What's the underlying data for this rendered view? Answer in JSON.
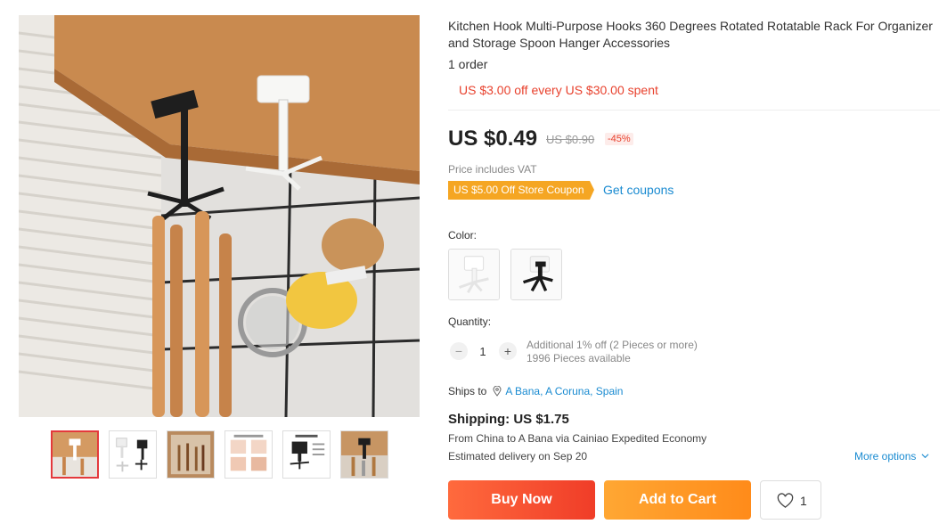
{
  "product": {
    "title": "Kitchen Hook Multi-Purpose Hooks 360 Degrees Rotated Rotatable Rack For Organizer and Storage Spoon Hanger Accessories",
    "orders": "1 order",
    "promo": "US $3.00 off every US $30.00 spent",
    "price": "US $0.49",
    "original_price": "US $0.90",
    "discount": "-45%",
    "vat_note": "Price includes VAT",
    "coupon_badge": "US $5.00 Off Store Coupon",
    "get_coupons": "Get coupons"
  },
  "gallery": {
    "main_image_icon": "kitchen-hook-photo",
    "thumbnails": [
      {
        "icon": "hook-photo-white",
        "active": true
      },
      {
        "icon": "hook-photo-product-set"
      },
      {
        "icon": "hook-photo-cabinet"
      },
      {
        "icon": "hook-photo-how-to-use"
      },
      {
        "icon": "hook-photo-product-details"
      },
      {
        "icon": "hook-photo-black"
      }
    ]
  },
  "color": {
    "label": "Color:",
    "options": [
      {
        "icon": "white-hook-swatch",
        "color": "#ffffff"
      },
      {
        "icon": "black-hook-swatch",
        "color": "#1a1a1a"
      }
    ]
  },
  "quantity": {
    "label": "Quantity:",
    "minus": "−",
    "plus": "+",
    "value": "1",
    "note_line1": "Additional 1% off (2 Pieces or more)",
    "note_line2": "1996 Pieces available"
  },
  "shipping": {
    "ships_to_label": "Ships to",
    "destination": "A Bana, A Coruna, Spain",
    "cost": "Shipping: US $1.75",
    "from": "From China to A Bana via Cainiao Expedited Economy",
    "estimated": "Estimated delivery on Sep 20",
    "more_options": "More options"
  },
  "actions": {
    "buy_now": "Buy Now",
    "add_to_cart": "Add to Cart",
    "wishlist_count": "1"
  },
  "colors": {
    "accent_red": "#e8412d",
    "link_blue": "#1a8bd1",
    "coupon_orange": "#f5a623",
    "buy_now": "#f03d28",
    "add_to_cart": "#ff8b1a"
  }
}
